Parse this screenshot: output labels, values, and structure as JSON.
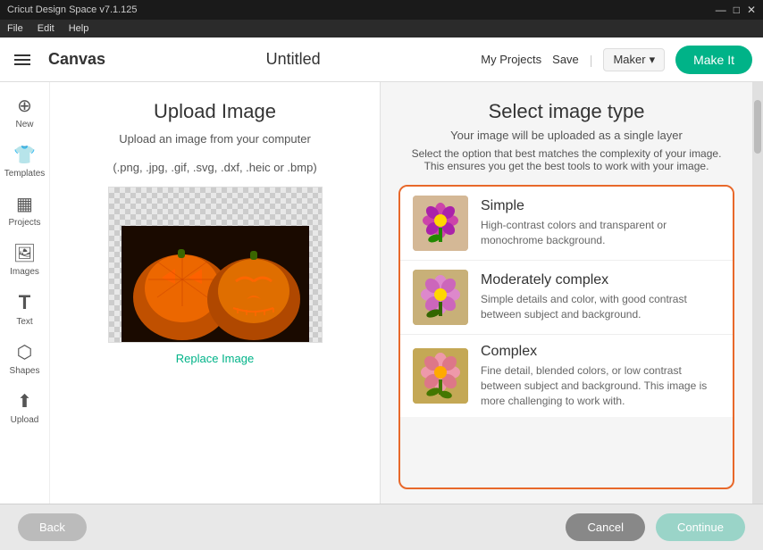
{
  "titlebar": {
    "title": "Cricut Design Space v7.1.125",
    "min": "—",
    "max": "□",
    "close": "✕"
  },
  "menubar": {
    "items": [
      "File",
      "Edit",
      "Help"
    ]
  },
  "header": {
    "app_title": "Canvas",
    "doc_title": "Untitled",
    "my_projects": "My Projects",
    "save": "Save",
    "maker": "Maker",
    "make_it": "Make It"
  },
  "sidebar": {
    "items": [
      {
        "id": "new",
        "label": "New",
        "icon": "+"
      },
      {
        "id": "templates",
        "label": "Templates",
        "icon": "👕"
      },
      {
        "id": "projects",
        "label": "Projects",
        "icon": "▦"
      },
      {
        "id": "images",
        "label": "Images",
        "icon": "🖼"
      },
      {
        "id": "text",
        "label": "Text",
        "icon": "T"
      },
      {
        "id": "shapes",
        "label": "Shapes",
        "icon": "⬡"
      },
      {
        "id": "upload",
        "label": "Upload",
        "icon": "⬆"
      }
    ]
  },
  "upload_section": {
    "title": "Upload Image",
    "description_line1": "Upload an image from your computer",
    "description_line2": "(.png, .jpg, .gif, .svg, .dxf, .heic or .bmp)",
    "replace_link": "Replace Image"
  },
  "select_section": {
    "title": "Select image type",
    "subtitle": "Your image will be uploaded as a single layer",
    "description": "Select the option that best matches the complexity of your image.\nThis ensures you get the best tools to work with your image.",
    "options": [
      {
        "id": "simple",
        "name": "Simple",
        "description": "High-contrast colors and transparent or monochrome background."
      },
      {
        "id": "moderately-complex",
        "name": "Moderately complex",
        "description": "Simple details and color, with good contrast between subject and background."
      },
      {
        "id": "complex",
        "name": "Complex",
        "description": "Fine detail, blended colors, or low contrast between subject and background. This image is more challenging to work with."
      }
    ]
  },
  "bottom_bar": {
    "back": "Back",
    "cancel": "Cancel",
    "continue": "Continue"
  }
}
